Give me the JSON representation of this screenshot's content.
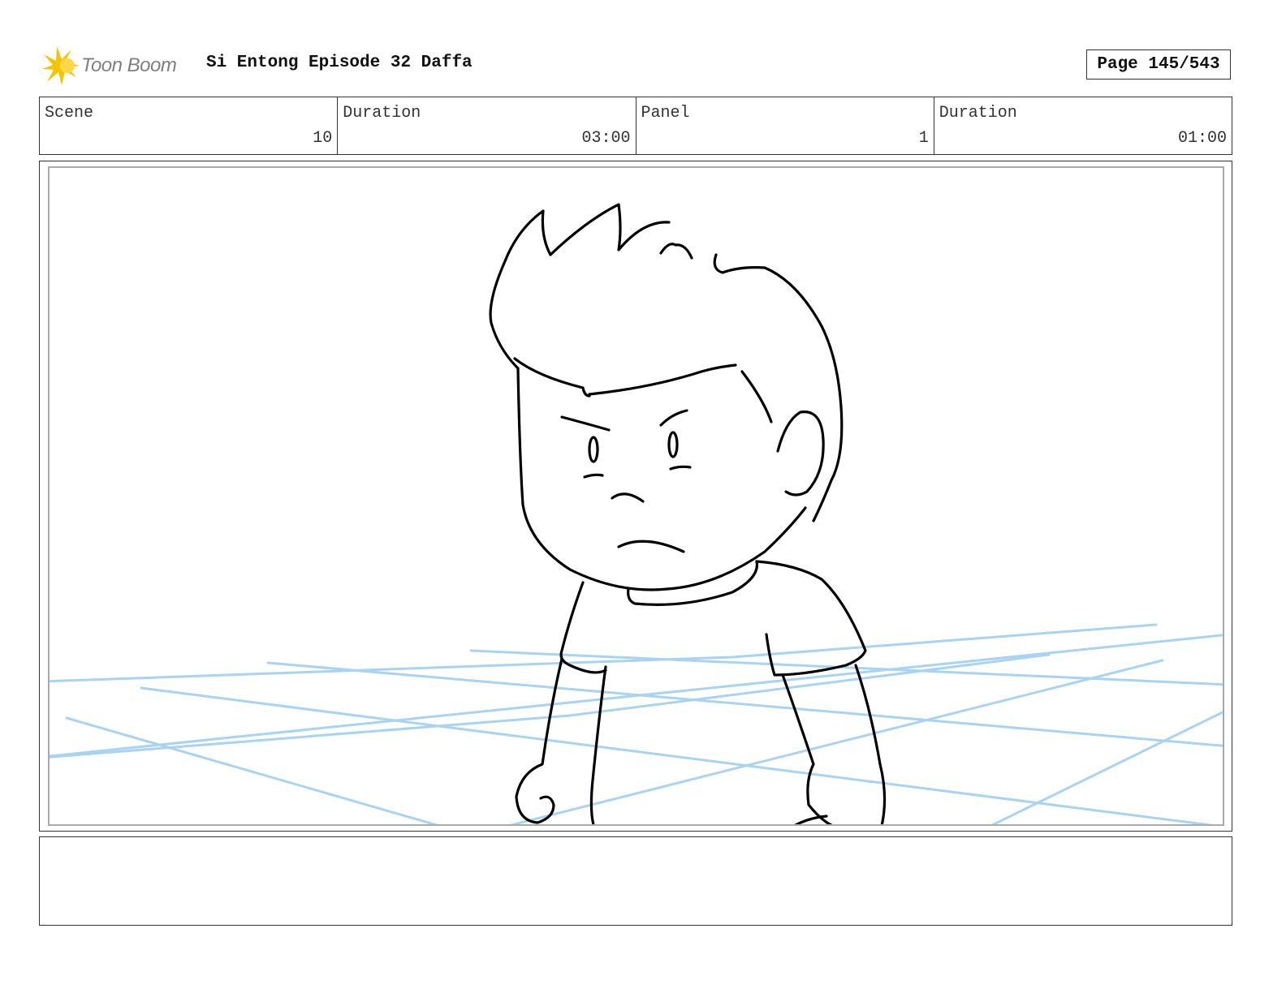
{
  "header": {
    "logo_text": "Toon Boom",
    "title": "Si Entong Episode 32 Daffa",
    "page": "Page 145/543"
  },
  "info": {
    "scene_label": "Scene",
    "scene_value": "10",
    "scene_duration_label": "Duration",
    "scene_duration_value": "03:00",
    "panel_label": "Panel",
    "panel_value": "1",
    "panel_duration_label": "Duration",
    "panel_duration_value": "01:00"
  },
  "notes": {
    "text": ""
  },
  "colors": {
    "sketch_line": "#000000",
    "perspective_line": "#a9d3f2",
    "logo_yellow": "#f5c400",
    "logo_text": "#7f7f7f"
  }
}
